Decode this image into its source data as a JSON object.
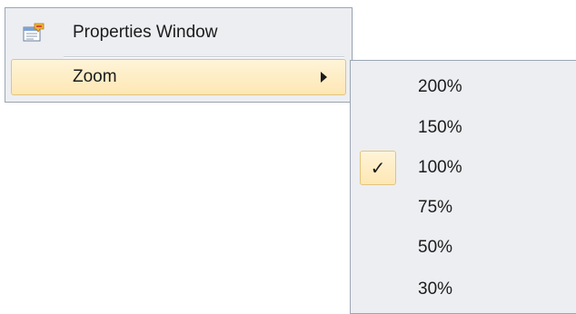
{
  "context_menu": {
    "items": [
      {
        "label": "Properties Window",
        "icon": "properties-window-icon",
        "has_submenu": false
      },
      {
        "label": "Zoom",
        "icon": "",
        "has_submenu": true,
        "highlighted": true
      }
    ]
  },
  "zoom_submenu": {
    "items": [
      {
        "label": "200%",
        "checked": false
      },
      {
        "label": "150%",
        "checked": false
      },
      {
        "label": "100%",
        "checked": true
      },
      {
        "label": "75%",
        "checked": false
      },
      {
        "label": "50%",
        "checked": false
      },
      {
        "label": "30%",
        "checked": false
      }
    ],
    "check_glyph": "✓"
  },
  "colors": {
    "menu_background": "#eceef2",
    "menu_border": "#9ba6b4",
    "highlight_top": "#fff4d8",
    "highlight_bottom": "#fde7b4",
    "highlight_border": "#e3c47e"
  }
}
